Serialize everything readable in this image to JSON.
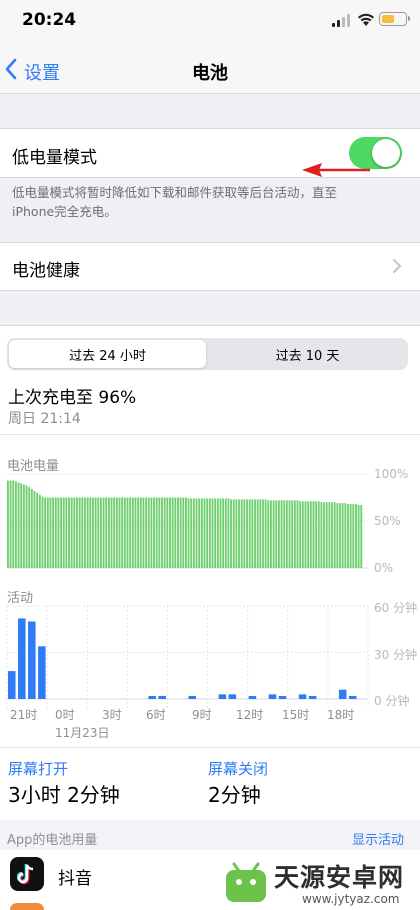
{
  "status_bar": {
    "time": "20:24",
    "battery_level": 0.55
  },
  "nav": {
    "back_label": "设置",
    "title": "电池"
  },
  "low_power": {
    "label": "低电量模式",
    "enabled": true,
    "description_line1": "低电量模式将暂时降低如下载和邮件获取等后台活动，直至",
    "description_line2": "iPhone完全充电。"
  },
  "battery_health": {
    "label": "电池健康"
  },
  "segmented": {
    "tab_24h": "过去 24 小时",
    "tab_10d": "过去 10 天",
    "selected": 0
  },
  "last_charge": {
    "title": "上次充电至 96%",
    "time": "周日 21:14"
  },
  "chart_data": [
    {
      "type": "bar",
      "title": "电池电量",
      "y_ticks": [
        "100%",
        "50%",
        "0%"
      ],
      "ylim": [
        0,
        100
      ],
      "color": "#6fcf6f",
      "values": [
        93,
        93,
        93,
        92,
        91,
        90,
        89,
        88,
        86,
        84,
        82,
        80,
        78,
        76,
        75,
        75,
        75,
        75,
        75,
        75,
        75,
        75,
        75,
        75,
        75,
        75,
        75,
        75,
        75,
        75,
        75,
        75,
        75,
        75,
        75,
        75,
        75,
        75,
        75,
        75,
        75,
        75,
        75,
        75,
        75,
        75,
        75,
        75,
        75,
        75,
        75,
        75,
        75,
        75,
        75,
        75,
        75,
        75,
        75,
        75,
        75,
        75,
        75,
        75,
        75,
        75,
        75,
        75,
        74,
        74,
        74,
        74,
        74,
        74,
        74,
        74,
        74,
        74,
        74,
        74,
        74,
        74,
        74,
        74,
        73,
        73,
        73,
        73,
        73,
        73,
        73,
        73,
        73,
        73,
        73,
        73,
        73,
        73,
        72,
        72,
        72,
        72,
        72,
        72,
        72,
        72,
        72,
        72,
        72,
        72,
        71,
        71,
        71,
        71,
        71,
        71,
        71,
        71,
        70,
        70,
        70,
        70,
        70,
        70,
        69,
        69,
        69,
        69,
        68,
        68,
        68,
        68,
        67,
        67
      ]
    },
    {
      "type": "bar",
      "title": "活动",
      "y_ticks": [
        "60 分钟",
        "30 分钟",
        "0 分钟"
      ],
      "ylim": [
        0,
        60
      ],
      "color": "#2f7cf6",
      "values": [
        18,
        52,
        50,
        34,
        0,
        0,
        0,
        0,
        0,
        0,
        0,
        0,
        0,
        0,
        1,
        2,
        0,
        0,
        1,
        0,
        0,
        3,
        3,
        0,
        1,
        0,
        3,
        1,
        0,
        3,
        1,
        0,
        0,
        6,
        1,
        0
      ],
      "x_ticks": [
        "21时",
        "0时",
        "3时",
        "6时",
        "9时",
        "12时",
        "15时",
        "18时"
      ],
      "date_label": "11月23日"
    }
  ],
  "screen": {
    "on_label": "屏幕打开",
    "on_value": "3小时 2分钟",
    "off_label": "屏幕关闭",
    "off_value": "2分钟"
  },
  "usage": {
    "header": "App的电池用量",
    "show_activity": "显示活动"
  },
  "apps": [
    {
      "name": "抖音"
    }
  ],
  "colors": {
    "accent": "#2f7cf6",
    "toggle_on": "#4cd964",
    "arrow": "#e02020"
  }
}
